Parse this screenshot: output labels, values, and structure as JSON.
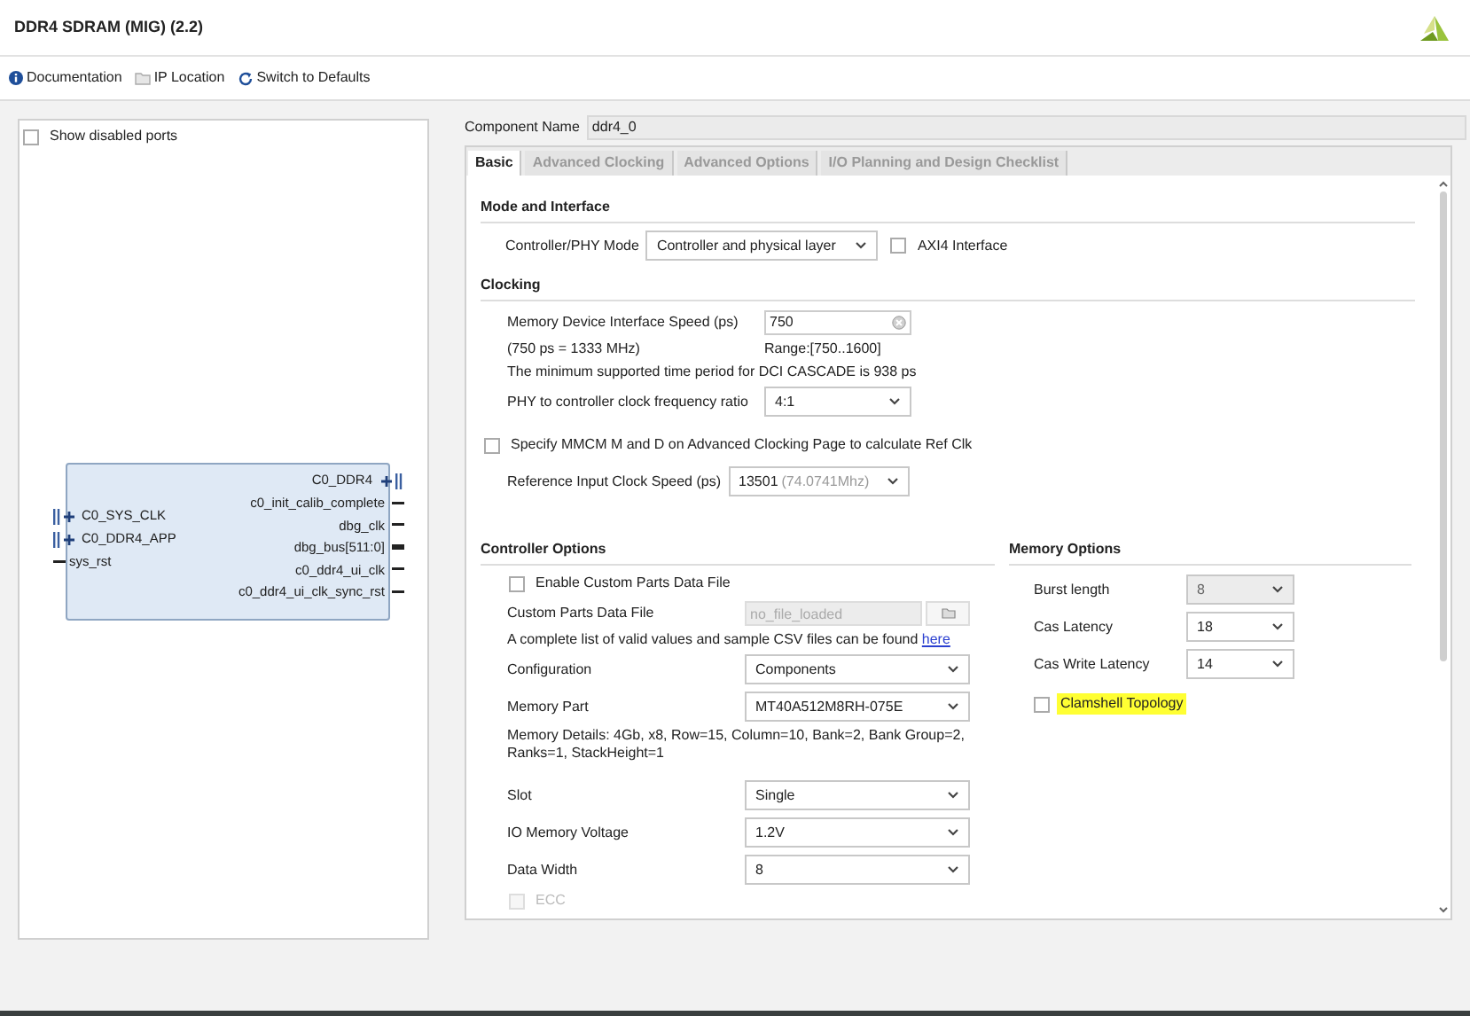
{
  "window": {
    "title": "DDR4 SDRAM (MIG) (2.2)"
  },
  "toolbar": [
    {
      "kind": "info",
      "label": "Documentation"
    },
    {
      "kind": "folder",
      "label": "IP Location"
    },
    {
      "kind": "refresh",
      "label": "Switch to Defaults"
    }
  ],
  "left_panel": {
    "show_disabled_ports": {
      "label": "Show disabled ports",
      "checked": false
    },
    "block": {
      "left_ports": [
        {
          "kind": "bus",
          "label": "C0_SYS_CLK"
        },
        {
          "kind": "bus",
          "label": "C0_DDR4_APP"
        },
        {
          "kind": "wire",
          "label": "sys_rst"
        }
      ],
      "right_ports": [
        {
          "kind": "bus",
          "label": "C0_DDR4"
        },
        {
          "kind": "wire",
          "label": "c0_init_calib_complete"
        },
        {
          "kind": "wire",
          "label": "dbg_clk"
        },
        {
          "kind": "thick",
          "label": "dbg_bus[511:0]"
        },
        {
          "kind": "wire",
          "label": "c0_ddr4_ui_clk"
        },
        {
          "kind": "wire",
          "label": "c0_ddr4_ui_clk_sync_rst"
        }
      ]
    }
  },
  "component_name": {
    "label": "Component Name",
    "value": "ddr4_0"
  },
  "tabs": [
    {
      "label": "Basic",
      "selected": true
    },
    {
      "label": "Advanced Clocking",
      "selected": false
    },
    {
      "label": "Advanced Options",
      "selected": false
    },
    {
      "label": "I/O Planning and Design Checklist",
      "selected": false
    }
  ],
  "mode_and_interface": {
    "title": "Mode and Interface",
    "controller_phy_mode": {
      "label": "Controller/PHY Mode",
      "value": "Controller and physical layer"
    },
    "axi4_interface": {
      "label": "AXI4 Interface",
      "checked": false
    }
  },
  "clocking": {
    "title": "Clocking",
    "interface_speed": {
      "label": "Memory Device Interface Speed (ps)",
      "value": "750"
    },
    "speed_note": "(750 ps = 1333 MHz)",
    "range": "Range:[750..1600]",
    "min_period_note": "The minimum supported time period for DCI CASCADE is 938 ps",
    "clock_ratio": {
      "label": "PHY to controller clock frequency ratio",
      "value": "4:1"
    },
    "specify_mmcm": {
      "label": "Specify MMCM M and D on Advanced Clocking Page to calculate Ref Clk",
      "checked": false
    },
    "reference_clock": {
      "label": "Reference Input Clock Speed (ps)",
      "value": "13501",
      "hint": "(74.0741Mhz)"
    }
  },
  "controller_options": {
    "title": "Controller Options",
    "enable_custom_parts": {
      "label": "Enable Custom Parts Data File",
      "checked": false
    },
    "custom_parts_file": {
      "label": "Custom Parts Data File",
      "placeholder": "no_file_loaded"
    },
    "csv_note": "A complete list of valid values and sample CSV files can be found",
    "csv_link": "here",
    "fields": [
      {
        "label": "Configuration",
        "value": "Components"
      },
      {
        "label": "Memory Part",
        "value": "MT40A512M8RH-075E"
      }
    ],
    "memory_details": "Memory Details: 4Gb, x8, Row=15, Column=10, Bank=2, Bank Group=2, Ranks=1, StackHeight=1",
    "more_fields": [
      {
        "label": "Slot",
        "value": "Single"
      },
      {
        "label": "IO Memory Voltage",
        "value": "1.2V"
      },
      {
        "label": "Data Width",
        "value": "8"
      }
    ],
    "ecc": {
      "label": "ECC",
      "checked": false,
      "disabled": true
    }
  },
  "memory_options": {
    "title": "Memory Options",
    "fields": [
      {
        "label": "Burst length",
        "value": "8",
        "disabled": true
      },
      {
        "label": "Cas Latency",
        "value": "18",
        "disabled": false
      },
      {
        "label": "Cas Write Latency",
        "value": "14",
        "disabled": false
      }
    ],
    "clamshell_topology": {
      "label": "Clamshell Topology",
      "checked": false,
      "highlighted": true
    }
  }
}
